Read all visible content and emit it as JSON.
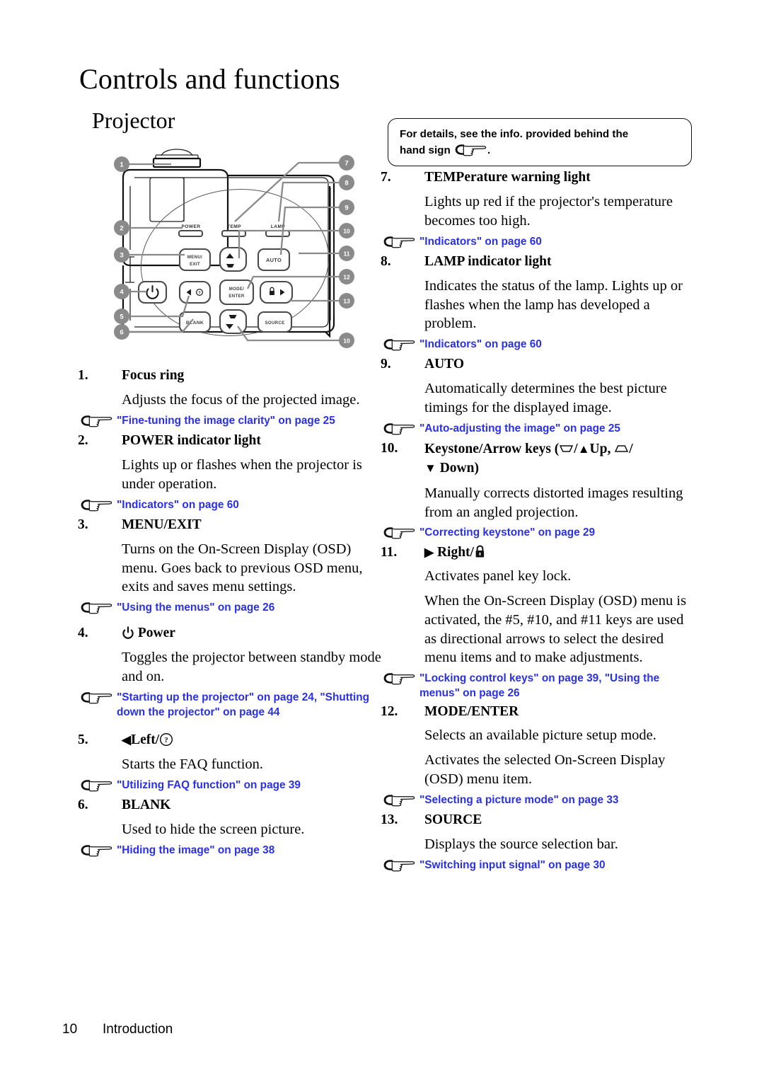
{
  "page": {
    "title": "Controls and functions",
    "section": "Projector",
    "footer_page_number": "10",
    "footer_section": "Introduction"
  },
  "colors": {
    "link_blue": "#2a30e6",
    "callout_gray": "#8a8a8a",
    "text_black": "#000000"
  },
  "note_box": {
    "line1": "For details, see the info. provided behind the",
    "line2_before": "hand sign",
    "line2_after": ".",
    "hand_icon": "hand-pointing-icon"
  },
  "diagram": {
    "name": "projector-top-view-diagram",
    "callouts": [
      "1",
      "2",
      "3",
      "4",
      "5",
      "6",
      "7",
      "8",
      "9",
      "10",
      "11",
      "12",
      "13",
      "10"
    ],
    "indicator_labels": [
      "POWER",
      "TEMP",
      "LAMP"
    ],
    "button_labels": [
      "MENU/ EXIT",
      "AUTO",
      "MODE/ ENTER",
      "BLANK",
      "SOURCE"
    ],
    "button_glyphs": [
      "power-icon",
      "left-faq-icon",
      "right-lock-icon",
      "keystone-up-icon",
      "keystone-down-icon"
    ]
  },
  "left_column": [
    {
      "num": "1.",
      "title": "Focus ring",
      "body": [
        "Adjusts the focus of the projected image."
      ],
      "refs": [
        {
          "text": "\"Fine-tuning the image clarity\" on page 25"
        }
      ]
    },
    {
      "num": "2.",
      "title": "POWER indicator light",
      "body": [
        "Lights up or flashes when the projector is under operation."
      ],
      "refs": [
        {
          "text": "\"Indicators\" on page 60"
        }
      ]
    },
    {
      "num": "3.",
      "title": "MENU/EXIT",
      "body": [
        "Turns on the On-Screen Display (OSD) menu. Goes back to previous OSD menu, exits and saves menu settings."
      ],
      "refs": [
        {
          "text": "\"Using the menus\" on page 26"
        }
      ]
    },
    {
      "num": "4.",
      "title": "Power",
      "title_icon": "power-icon",
      "body": [
        "Toggles the projector between standby mode and on."
      ],
      "refs": [
        {
          "text": "\"Starting up the projector\" on page 24, \"Shutting down the projector\" on page 44"
        }
      ]
    },
    {
      "num": "5.",
      "title": "Left/",
      "title_icon_pre": "left-triangle-icon",
      "title_icon_post": "question-mark-circle-icon",
      "body": [
        "Starts the FAQ function."
      ],
      "refs": [
        {
          "text": "\"Utilizing FAQ function\" on page 39"
        }
      ]
    },
    {
      "num": "6.",
      "title": "BLANK",
      "body": [
        "Used to hide the screen picture."
      ],
      "refs": [
        {
          "text": "\"Hiding the image\" on page 38"
        }
      ]
    }
  ],
  "right_column": [
    {
      "num": "7.",
      "title": "TEMPerature warning light",
      "body": [
        "Lights up red if the projector's temperature becomes too high."
      ],
      "refs": [
        {
          "text": "\"Indicators\" on page 60"
        }
      ]
    },
    {
      "num": "8.",
      "title": "LAMP indicator light",
      "body": [
        "Indicates the status of the lamp. Lights up or flashes when the lamp has developed a problem."
      ],
      "refs": [
        {
          "text": "\"Indicators\" on page 60"
        }
      ]
    },
    {
      "num": "9.",
      "title": "AUTO",
      "body": [
        "Automatically determines the best picture timings for the displayed image."
      ],
      "refs": [
        {
          "text": "\"Auto-adjusting the image\" on page 25"
        }
      ]
    },
    {
      "num": "10.",
      "title_part1": "Keystone/Arrow keys (",
      "title_part2": "/",
      "title_part3": "Up,",
      "title_part4": "/",
      "title_part5": "Down)",
      "title_icons": [
        "keystone-wide-bottom-icon",
        "up-triangle-icon",
        "keystone-wide-top-icon",
        "down-triangle-icon"
      ],
      "body": [
        "Manually corrects distorted images resulting from an angled projection."
      ],
      "refs": [
        {
          "text": "\"Correcting keystone\" on page 29"
        }
      ]
    },
    {
      "num": "11.",
      "title": "Right/",
      "title_icon_pre": "right-triangle-icon",
      "title_icon_post": "lock-icon",
      "body": [
        "Activates panel key lock.",
        "When the On-Screen Display (OSD) menu is activated, the #5, #10, and #11 keys are used as directional arrows to select the desired menu items and to make adjustments."
      ],
      "refs": [
        {
          "text": "\"Locking control keys\" on page 39, \"Using the menus\" on page 26"
        }
      ]
    },
    {
      "num": "12.",
      "title": "MODE/ENTER",
      "body": [
        "Selects an available picture setup mode.",
        "Activates the selected On-Screen Display (OSD) menu item."
      ],
      "refs": [
        {
          "text": "\"Selecting a picture mode\" on page 33"
        }
      ]
    },
    {
      "num": "13.",
      "title": "SOURCE",
      "body": [
        "Displays the source selection bar."
      ],
      "refs": [
        {
          "text": "\"Switching input signal\" on page 30"
        }
      ]
    }
  ]
}
